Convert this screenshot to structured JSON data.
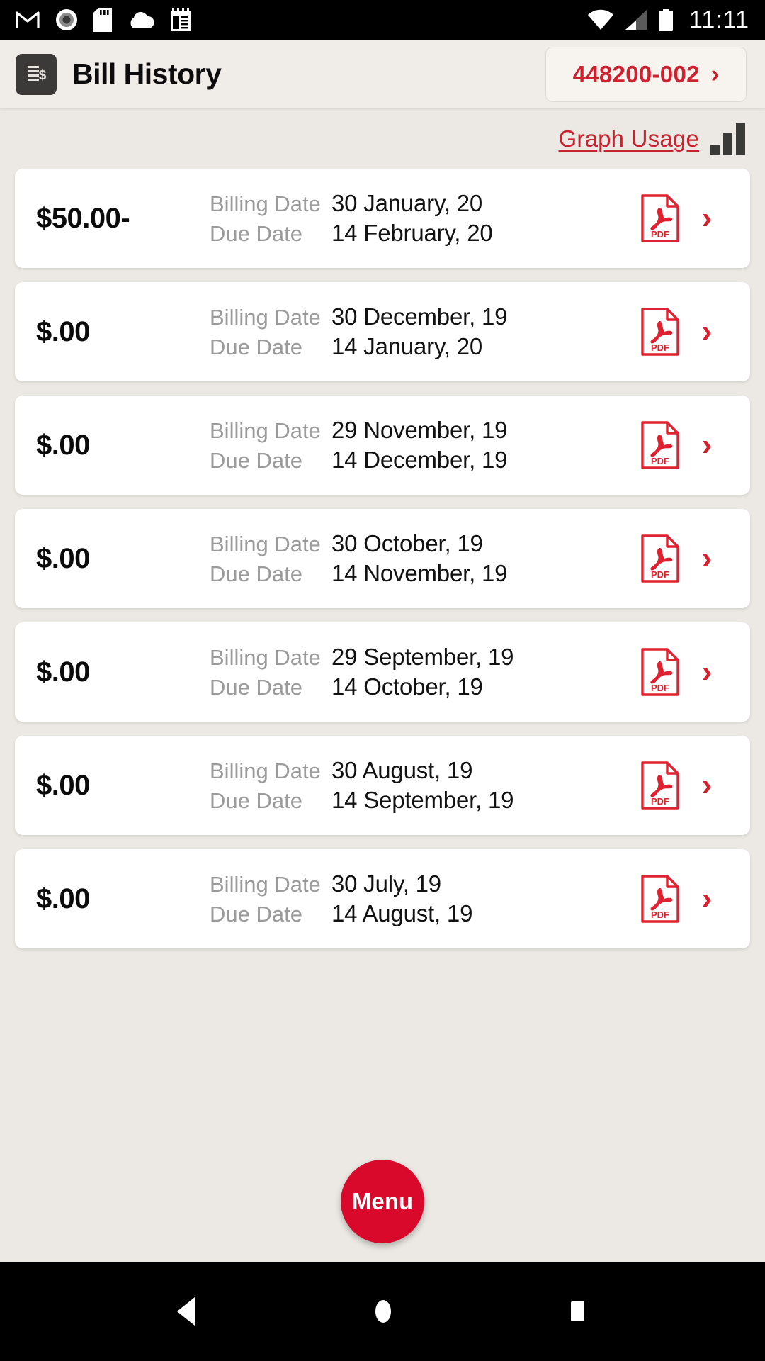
{
  "status_bar": {
    "time": "11:11",
    "left_icons": [
      "gmail-icon",
      "record-icon",
      "sd-card-icon",
      "cloud-icon",
      "calendar-icon"
    ],
    "right_icons": [
      "wifi-icon",
      "cell-signal-icon",
      "battery-icon"
    ]
  },
  "header": {
    "icon": "bill-document-icon",
    "title": "Bill History",
    "account": {
      "number": "448200-002",
      "chevron": "›"
    }
  },
  "toolbar": {
    "graph_usage_label": "Graph Usage",
    "graph_icon": "bar-chart-icon"
  },
  "labels": {
    "billing_date": "Billing Date",
    "due_date": "Due Date",
    "pdf": "PDF",
    "chevron": "›"
  },
  "bills": [
    {
      "amount": "$50.00-",
      "billing_date": "30 January, 20",
      "due_date": "14 February, 20"
    },
    {
      "amount": "$.00",
      "billing_date": "30 December, 19",
      "due_date": "14 January, 20"
    },
    {
      "amount": "$.00",
      "billing_date": "29 November, 19",
      "due_date": "14 December, 19"
    },
    {
      "amount": "$.00",
      "billing_date": "30 October, 19",
      "due_date": "14 November, 19"
    },
    {
      "amount": "$.00",
      "billing_date": "29 September, 19",
      "due_date": "14 October, 19"
    },
    {
      "amount": "$.00",
      "billing_date": "30 August, 19",
      "due_date": "14 September, 19"
    },
    {
      "amount": "$.00",
      "billing_date": "30 July, 19",
      "due_date": "14 August, 19"
    }
  ],
  "fab": {
    "label": "Menu"
  },
  "nav_bar": {
    "back": "back-icon",
    "home": "home-icon",
    "recents": "recents-icon"
  },
  "colors": {
    "accent_red": "#cf2030",
    "fab_red": "#d9092b",
    "page_bg": "#ece8e3",
    "card_bg": "#ffffff",
    "label_gray": "#9b9b9b"
  }
}
